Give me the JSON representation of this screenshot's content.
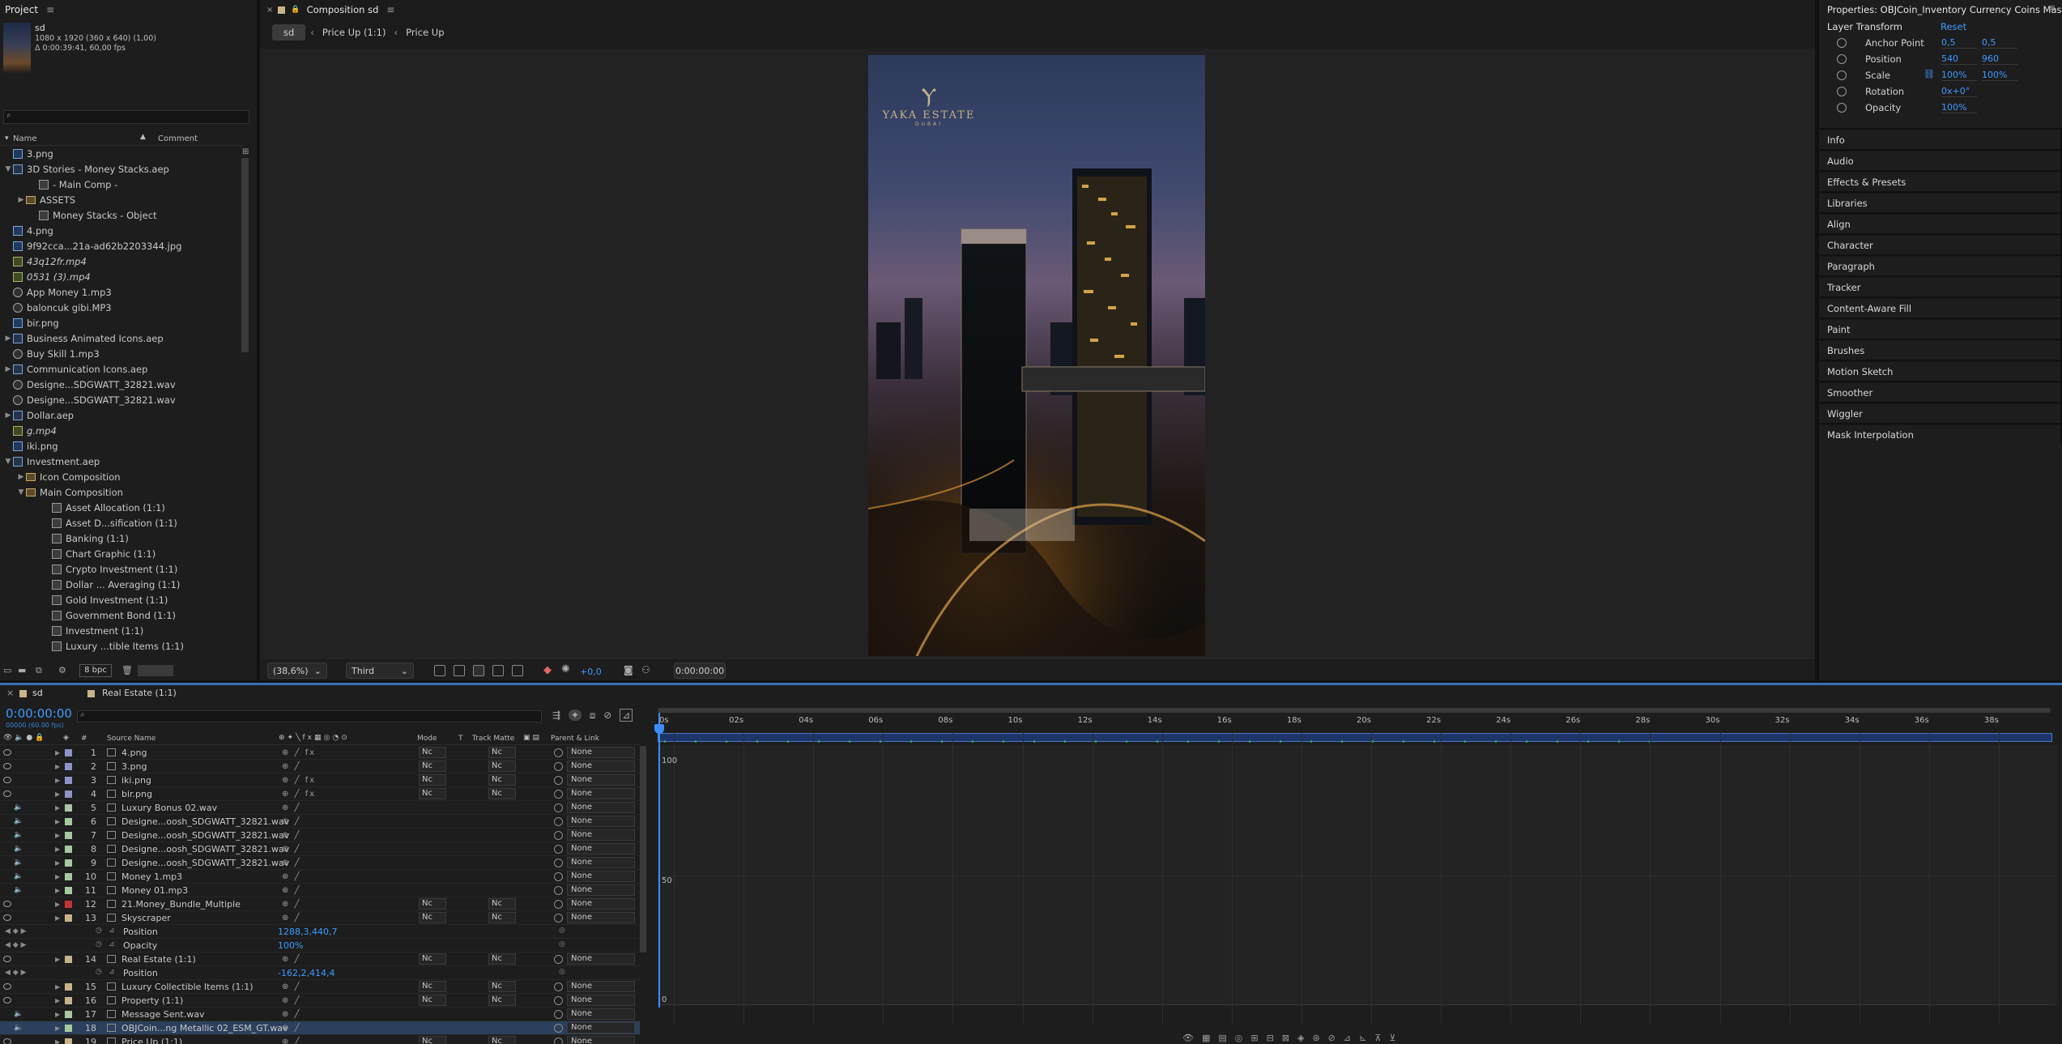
{
  "project": {
    "title": "Project",
    "comp_name": "sd",
    "comp_info1": "1080 x 1920  (360 x 640) (1,00)",
    "comp_info2": "Δ 0:00:39:41, 60,00 fps",
    "search_placeholder": "",
    "col_name": "Name",
    "col_comment": "Comment",
    "items": [
      {
        "label": "3.png",
        "icon": "img",
        "indent": 0,
        "twirl": ""
      },
      {
        "label": "3D Stories - Money Stacks.aep",
        "icon": "aep",
        "indent": 0,
        "twirl": "▼"
      },
      {
        "label": "- Main Comp -",
        "icon": "comp",
        "indent": 2,
        "twirl": ""
      },
      {
        "label": "ASSETS",
        "icon": "folder",
        "indent": 1,
        "twirl": "▶"
      },
      {
        "label": "Money Stacks - Object",
        "icon": "comp",
        "indent": 2,
        "twirl": ""
      },
      {
        "label": "4.png",
        "icon": "img",
        "indent": 0,
        "twirl": ""
      },
      {
        "label": "9f92cca...21a-ad62b2203344.jpg",
        "icon": "img",
        "indent": 0,
        "twirl": ""
      },
      {
        "label": "43q12fr.mp4",
        "icon": "vid",
        "indent": 0,
        "twirl": "",
        "italic": true
      },
      {
        "label": "0531 (3).mp4",
        "icon": "vid",
        "indent": 0,
        "twirl": "",
        "italic": true
      },
      {
        "label": "App Money 1.mp3",
        "icon": "aud",
        "indent": 0,
        "twirl": ""
      },
      {
        "label": "baloncuk gibi.MP3",
        "icon": "aud",
        "indent": 0,
        "twirl": ""
      },
      {
        "label": "bir.png",
        "icon": "img",
        "indent": 0,
        "twirl": ""
      },
      {
        "label": "Business Animated Icons.aep",
        "icon": "aep",
        "indent": 0,
        "twirl": "▶"
      },
      {
        "label": "Buy Skill 1.mp3",
        "icon": "aud",
        "indent": 0,
        "twirl": ""
      },
      {
        "label": "Communication Icons.aep",
        "icon": "aep",
        "indent": 0,
        "twirl": "▶"
      },
      {
        "label": "Designe...SDGWATT_32821.wav",
        "icon": "aud",
        "indent": 0,
        "twirl": ""
      },
      {
        "label": "Designe...SDGWATT_32821.wav",
        "icon": "aud",
        "indent": 0,
        "twirl": ""
      },
      {
        "label": "Dollar.aep",
        "icon": "aep",
        "indent": 0,
        "twirl": "▶"
      },
      {
        "label": "g.mp4",
        "icon": "vid",
        "indent": 0,
        "twirl": "",
        "italic": true
      },
      {
        "label": "iki.png",
        "icon": "img",
        "indent": 0,
        "twirl": ""
      },
      {
        "label": "Investment.aep",
        "icon": "aep",
        "indent": 0,
        "twirl": "▼"
      },
      {
        "label": "Icon Composition",
        "icon": "folder",
        "indent": 1,
        "twirl": "▶"
      },
      {
        "label": "Main Composition",
        "icon": "folder",
        "indent": 1,
        "twirl": "▼"
      },
      {
        "label": "Asset Allocation (1:1)",
        "icon": "comp",
        "indent": 3,
        "twirl": ""
      },
      {
        "label": "Asset D...sification (1:1)",
        "icon": "comp",
        "indent": 3,
        "twirl": ""
      },
      {
        "label": "Banking (1:1)",
        "icon": "comp",
        "indent": 3,
        "twirl": ""
      },
      {
        "label": "Chart Graphic (1:1)",
        "icon": "comp",
        "indent": 3,
        "twirl": ""
      },
      {
        "label": "Crypto Investment (1:1)",
        "icon": "comp",
        "indent": 3,
        "twirl": ""
      },
      {
        "label": "Dollar ... Averaging (1:1)",
        "icon": "comp",
        "indent": 3,
        "twirl": ""
      },
      {
        "label": "Gold Investment (1:1)",
        "icon": "comp",
        "indent": 3,
        "twirl": ""
      },
      {
        "label": "Government Bond (1:1)",
        "icon": "comp",
        "indent": 3,
        "twirl": ""
      },
      {
        "label": "Investment (1:1)",
        "icon": "comp",
        "indent": 3,
        "twirl": ""
      },
      {
        "label": "Luxury ...tible Items (1:1)",
        "icon": "comp",
        "indent": 3,
        "twirl": ""
      }
    ],
    "bpc": "8 bpc"
  },
  "viewer": {
    "tab_title": "Composition sd",
    "crumb_active": "sd",
    "crumb_1": "Price Up (1:1)",
    "crumb_2": "Price Up",
    "logo_line1": "YAKA ESTATE",
    "logo_line2": "DUBAI",
    "zoom": "(38,6%)",
    "resolution": "Third",
    "exposure": "+0,0",
    "timecode": "0:00:00:00"
  },
  "properties": {
    "title": "Properties: OBJCoin_Inventory Currency Coins Massive",
    "group": "Layer Transform",
    "reset": "Reset",
    "rows": [
      {
        "label": "Anchor Point",
        "v1": "0,5",
        "v2": "0,5"
      },
      {
        "label": "Position",
        "v1": "540",
        "v2": "960"
      },
      {
        "label": "Scale",
        "v1": "100%",
        "v2": "100%"
      },
      {
        "label": "Rotation",
        "v1": "0x+0°",
        "v2": ""
      },
      {
        "label": "Opacity",
        "v1": "100%",
        "v2": ""
      }
    ],
    "sections": [
      "Info",
      "Audio",
      "Effects & Presets",
      "Libraries",
      "Align",
      "Character",
      "Paragraph",
      "Tracker",
      "Content-Aware Fill",
      "Paint",
      "Brushes",
      "Motion Sketch",
      "Smoother",
      "Wiggler",
      "Mask Interpolation"
    ]
  },
  "timeline": {
    "tab_sd": "sd",
    "tab_re": "Real Estate (1:1)",
    "timecode": "0:00:00:00",
    "fps": "00000 (60.00 fps)",
    "cols": {
      "source": "Source Name",
      "mode": "Mode",
      "t": "T",
      "track": "Track Matte",
      "parent": "Parent & Link"
    },
    "ruler": [
      "0s",
      "02s",
      "04s",
      "06s",
      "08s",
      "10s",
      "12s",
      "14s",
      "16s",
      "18s",
      "20s",
      "22s",
      "24s",
      "26s",
      "28s",
      "30s",
      "32s",
      "34s",
      "36s",
      "38s"
    ],
    "graph_labels": [
      "100",
      "50",
      "0"
    ],
    "layers": [
      {
        "num": "1",
        "name": "4.png",
        "color": "#8c93c8",
        "mode": "Nc",
        "tm": "Nc",
        "parent": "None",
        "vis": true,
        "fx": true
      },
      {
        "num": "2",
        "name": "3.png",
        "color": "#8c93c8",
        "mode": "Nc",
        "tm": "Nc",
        "parent": "None",
        "vis": true,
        "fx": false
      },
      {
        "num": "3",
        "name": "iki.png",
        "color": "#8c93c8",
        "mode": "Nc",
        "tm": "Nc",
        "parent": "None",
        "vis": true,
        "fx": true
      },
      {
        "num": "4",
        "name": "bir.png",
        "color": "#8c93c8",
        "mode": "Nc",
        "tm": "Nc",
        "parent": "None",
        "vis": true,
        "fx": true
      },
      {
        "num": "5",
        "name": "Luxury Bonus 02.wav",
        "color": "#a6c9a0",
        "mode": "",
        "tm": "",
        "parent": "None",
        "vis": false,
        "fx": false
      },
      {
        "num": "6",
        "name": "Designe...oosh_SDGWATT_32821.wav",
        "color": "#a6c9a0",
        "mode": "",
        "tm": "",
        "parent": "None",
        "vis": false,
        "fx": false
      },
      {
        "num": "7",
        "name": "Designe...oosh_SDGWATT_32821.wav",
        "color": "#a6c9a0",
        "mode": "",
        "tm": "",
        "parent": "None",
        "vis": false,
        "fx": false
      },
      {
        "num": "8",
        "name": "Designe...oosh_SDGWATT_32821.wav",
        "color": "#a6c9a0",
        "mode": "",
        "tm": "",
        "parent": "None",
        "vis": false,
        "fx": false
      },
      {
        "num": "9",
        "name": "Designe...oosh_SDGWATT_32821.wav",
        "color": "#a6c9a0",
        "mode": "",
        "tm": "",
        "parent": "None",
        "vis": false,
        "fx": false
      },
      {
        "num": "10",
        "name": "Money 1.mp3",
        "color": "#a6c9a0",
        "mode": "",
        "tm": "",
        "parent": "None",
        "vis": false,
        "fx": false
      },
      {
        "num": "11",
        "name": "Money 01.mp3",
        "color": "#a6c9a0",
        "mode": "",
        "tm": "",
        "parent": "None",
        "vis": false,
        "fx": false
      },
      {
        "num": "12",
        "name": "21.Money_Bundle_Multiple",
        "color": "#c43636",
        "mode": "Nc",
        "tm": "Nc",
        "parent": "None",
        "vis": true,
        "fx": false
      },
      {
        "num": "13",
        "name": "Skyscraper",
        "color": "#c9b48a",
        "mode": "Nc",
        "tm": "Nc",
        "parent": "None",
        "vis": true,
        "fx": false
      }
    ],
    "sub13": [
      {
        "label": "Position",
        "value": "1288,3,440,7"
      },
      {
        "label": "Opacity",
        "value": "100%"
      }
    ],
    "layer14": {
      "num": "14",
      "name": "Real Estate (1:1)",
      "color": "#c9b48a",
      "mode": "Nc",
      "tm": "Nc",
      "parent": "None"
    },
    "sub14": {
      "label": "Position",
      "value": "-162,2,414,4"
    },
    "layers2": [
      {
        "num": "15",
        "name": "Luxury Collectible Items (1:1)",
        "color": "#c9b48a",
        "mode": "Nc",
        "tm": "Nc",
        "parent": "None",
        "vis": true
      },
      {
        "num": "16",
        "name": "Property (1:1)",
        "color": "#c9b48a",
        "mode": "Nc",
        "tm": "Nc",
        "parent": "None",
        "vis": true
      },
      {
        "num": "17",
        "name": "Message Sent.wav",
        "color": "#a6c9a0",
        "mode": "",
        "tm": "",
        "parent": "None",
        "vis": false
      },
      {
        "num": "18",
        "name": "OBJCoin...ng Metallic 02_ESM_GT.wav",
        "color": "#a6c9a0",
        "mode": "",
        "tm": "",
        "parent": "None",
        "vis": false,
        "sel": true
      },
      {
        "num": "19",
        "name": "Price Up (1:1)",
        "color": "#c9b48a",
        "mode": "Nc",
        "tm": "Nc",
        "parent": "None",
        "vis": true
      }
    ]
  },
  "colors": {
    "accent": "#2d8cff",
    "selection": "#2c3f5c",
    "panel": "#1d1d1d",
    "layer_red": "#c43636"
  }
}
